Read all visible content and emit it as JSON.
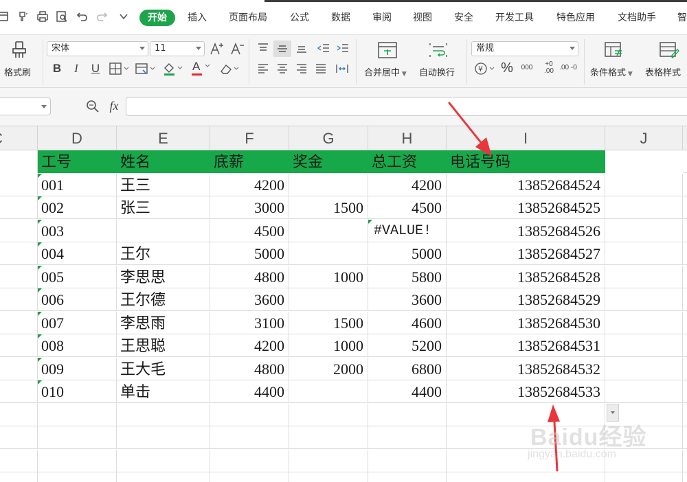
{
  "colors": {
    "accent": "#1ea54c",
    "header_fill": "#17a84a",
    "annotation_arrow": "#e8363c"
  },
  "menu": {
    "quick_icons": [
      "window-icon",
      "brush-icon",
      "print-icon",
      "print-preview-icon",
      "undo-icon",
      "redo-icon",
      "more-icon"
    ],
    "tabs": [
      "开始",
      "插入",
      "页面布局",
      "公式",
      "数据",
      "审阅",
      "视图",
      "安全",
      "开发工具",
      "特色应用",
      "文档助手",
      "智"
    ]
  },
  "ribbon": {
    "format_painter": "格式刷",
    "font_name": "宋体",
    "font_size": "11",
    "bold": "B",
    "italic": "I",
    "underline": "U",
    "font_color_letter": "A",
    "grow_font": "A⁺",
    "shrink_font": "A⁻",
    "merge_center": "合并居中",
    "wrap_text": "自动换行",
    "number_format": "常规",
    "currency": "¥",
    "percent": "%",
    "thousands": "000",
    "inc_decimal": "+0 .00",
    "dec_decimal": ".00 -0",
    "conditional_format": "条件格式",
    "table_style": "表格样式"
  },
  "formula_bar": {
    "fx_label": "fx",
    "name_box_value": "",
    "formula_value": ""
  },
  "grid": {
    "column_headers": [
      "C",
      "D",
      "E",
      "F",
      "G",
      "H",
      "I",
      "J"
    ],
    "header_row": [
      "工号",
      "姓名",
      "底薪",
      "奖金",
      "总工资",
      "电话号码"
    ],
    "rows": [
      {
        "id": "001",
        "name": "王三",
        "base": "4200",
        "bonus": "",
        "total": "4200",
        "phone": "13852684524"
      },
      {
        "id": "002",
        "name": "张三",
        "base": "3000",
        "bonus": "1500",
        "total": "4500",
        "phone": "13852684525"
      },
      {
        "id": "003",
        "name": "",
        "base": "4500",
        "bonus": "",
        "total": "#VALUE!",
        "phone": "13852684526"
      },
      {
        "id": "004",
        "name": "王尔",
        "base": "5000",
        "bonus": "",
        "total": "5000",
        "phone": "13852684527"
      },
      {
        "id": "005",
        "name": "李思思",
        "base": "4800",
        "bonus": "1000",
        "total": "5800",
        "phone": "13852684528"
      },
      {
        "id": "006",
        "name": "王尔德",
        "base": "3600",
        "bonus": "",
        "total": "3600",
        "phone": "13852684529"
      },
      {
        "id": "007",
        "name": "李思雨",
        "base": "3100",
        "bonus": "1500",
        "total": "4600",
        "phone": "13852684530"
      },
      {
        "id": "008",
        "name": "王思聪",
        "base": "4200",
        "bonus": "1000",
        "total": "5200",
        "phone": "13852684531"
      },
      {
        "id": "009",
        "name": "王大毛",
        "base": "4800",
        "bonus": "2000",
        "total": "6800",
        "phone": "13852684532"
      },
      {
        "id": "010",
        "name": "单击",
        "base": "4400",
        "bonus": "",
        "total": "4400",
        "phone": "13852684533"
      }
    ]
  },
  "watermark": {
    "logo": "Baidu经验",
    "url": "jingyan.baidu.com"
  }
}
